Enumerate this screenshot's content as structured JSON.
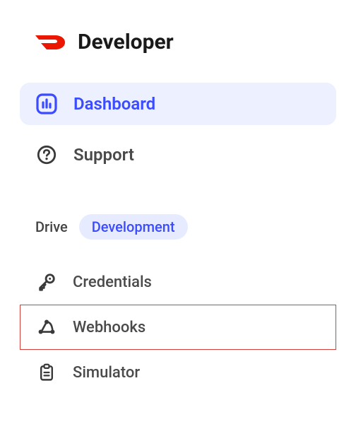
{
  "header": {
    "title": "Developer"
  },
  "nav": {
    "items": [
      {
        "label": "Dashboard",
        "active": true
      },
      {
        "label": "Support",
        "active": false
      }
    ]
  },
  "section": {
    "title": "Drive",
    "badge": "Development",
    "items": [
      {
        "label": "Credentials",
        "highlight": false
      },
      {
        "label": "Webhooks",
        "highlight": true
      },
      {
        "label": "Simulator",
        "highlight": false
      }
    ]
  }
}
